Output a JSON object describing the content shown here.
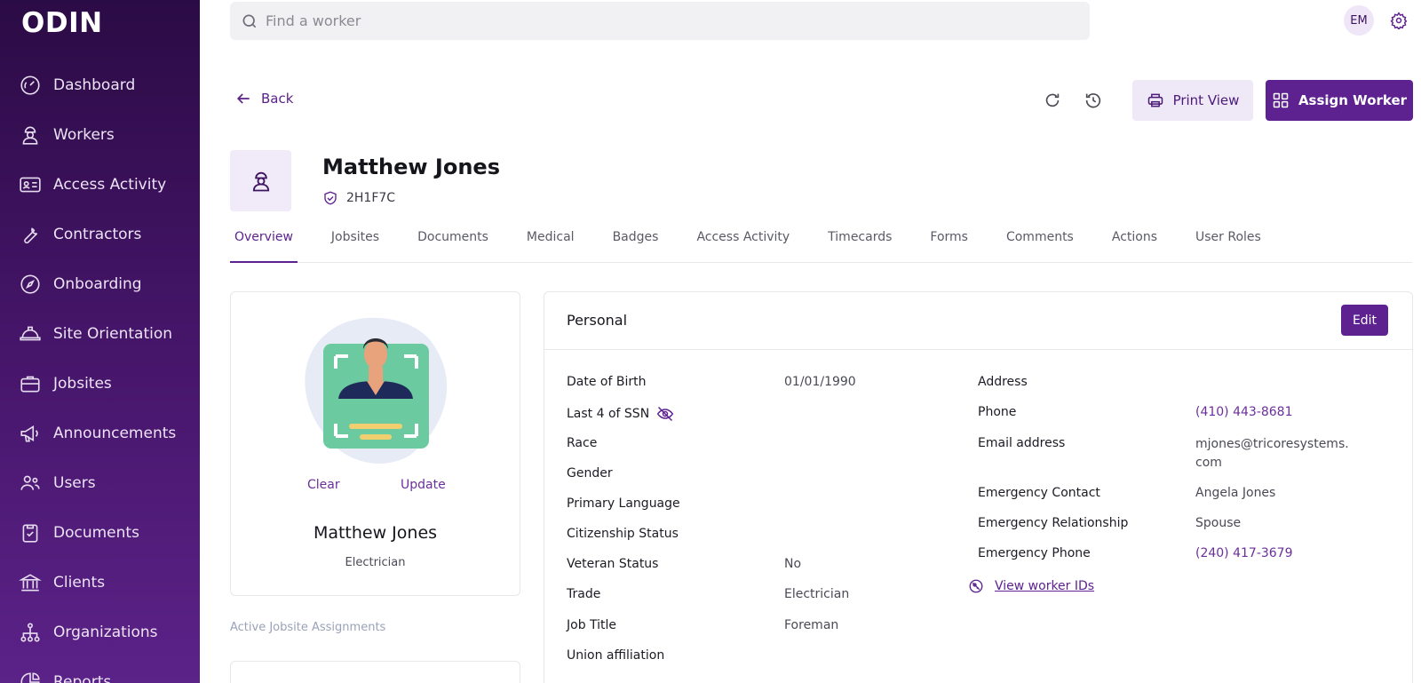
{
  "app": {
    "logo": "ODIN"
  },
  "sidebar": {
    "items": [
      {
        "label": "Dashboard",
        "icon": "dashboard-gauge-icon"
      },
      {
        "label": "Workers",
        "icon": "worker-icon"
      },
      {
        "label": "Access Activity",
        "icon": "id-card-icon"
      },
      {
        "label": "Contractors",
        "icon": "wrench-icon"
      },
      {
        "label": "Onboarding",
        "icon": "compass-icon"
      },
      {
        "label": "Site Orientation",
        "icon": "hard-hat-icon"
      },
      {
        "label": "Jobsites",
        "icon": "briefcase-icon"
      },
      {
        "label": "Announcements",
        "icon": "megaphone-icon"
      },
      {
        "label": "Users",
        "icon": "users-icon"
      },
      {
        "label": "Documents",
        "icon": "clipboard-icon"
      },
      {
        "label": "Clients",
        "icon": "bank-icon"
      },
      {
        "label": "Organizations",
        "icon": "org-chart-icon"
      },
      {
        "label": "Reports",
        "icon": "chart-icon"
      }
    ]
  },
  "topbar": {
    "search_placeholder": "Find a worker",
    "user_initials": "EM"
  },
  "actions": {
    "back_label": "Back",
    "print_label": "Print View",
    "assign_label": "Assign Worker"
  },
  "worker": {
    "name": "Matthew Jones",
    "badge_id": "2H1F7C",
    "trade": "Electrician"
  },
  "tabs": [
    {
      "label": "Overview",
      "active": true
    },
    {
      "label": "Jobsites",
      "active": false
    },
    {
      "label": "Documents",
      "active": false
    },
    {
      "label": "Medical",
      "active": false
    },
    {
      "label": "Badges",
      "active": false
    },
    {
      "label": "Access Activity",
      "active": false
    },
    {
      "label": "Timecards",
      "active": false
    },
    {
      "label": "Forms",
      "active": false
    },
    {
      "label": "Comments",
      "active": false
    },
    {
      "label": "Actions",
      "active": false
    },
    {
      "label": "User Roles",
      "active": false
    }
  ],
  "profile_card": {
    "clear_label": "Clear",
    "update_label": "Update",
    "name": "Matthew Jones",
    "trade": "Electrician",
    "active_assignments_label": "Active Jobsite Assignments"
  },
  "personal": {
    "title": "Personal",
    "edit_label": "Edit",
    "left_fields": [
      {
        "label": "Date of Birth",
        "value": "01/01/1990"
      },
      {
        "label": "Last 4 of SSN",
        "value": ""
      },
      {
        "label": "Race",
        "value": ""
      },
      {
        "label": "Gender",
        "value": ""
      },
      {
        "label": "Primary Language",
        "value": ""
      },
      {
        "label": "Citizenship Status",
        "value": ""
      },
      {
        "label": "Veteran Status",
        "value": "No"
      },
      {
        "label": "Trade",
        "value": "Electrician"
      },
      {
        "label": "Job Title",
        "value": "Foreman"
      },
      {
        "label": "Union affiliation",
        "value": ""
      }
    ],
    "right_fields": [
      {
        "label": "Address",
        "value": ""
      },
      {
        "label": "Phone",
        "value": "(410) 443-8681"
      },
      {
        "label": "Email address",
        "value": "mjones@tricoresystems.com"
      },
      {
        "label": "Emergency Contact",
        "value": "Angela Jones"
      },
      {
        "label": "Emergency Relationship",
        "value": "Spouse"
      },
      {
        "label": "Emergency Phone",
        "value": "(240) 417-3679"
      }
    ],
    "view_ids_label": "View worker IDs"
  },
  "colors": {
    "brand": "#5d2290",
    "sidebar_top": "#2b0b45",
    "sidebar_bottom": "#5b2288",
    "illustration_green": "#6ccaa0"
  }
}
